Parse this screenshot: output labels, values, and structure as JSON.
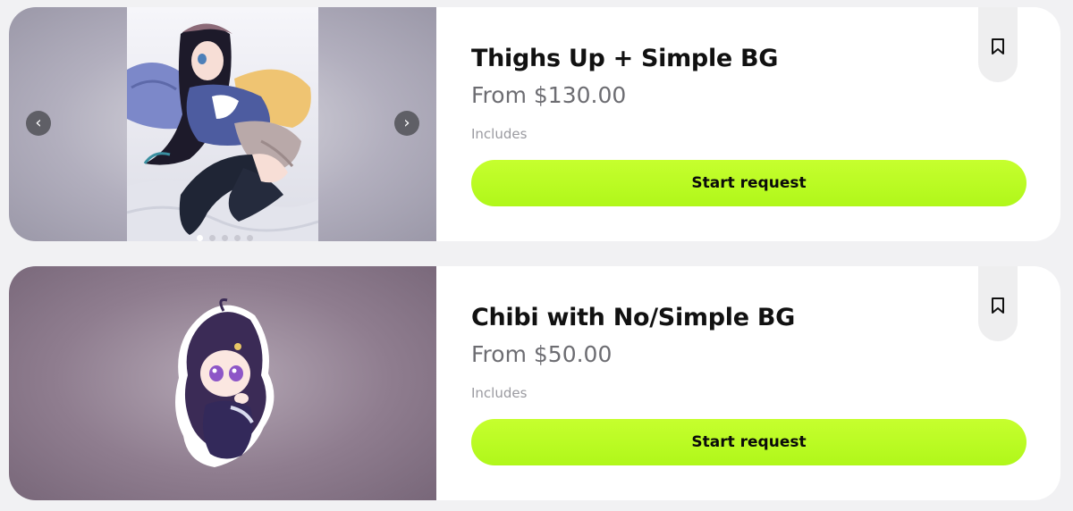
{
  "cards": [
    {
      "title": "Thighs Up + Simple BG",
      "price": "From $130.00",
      "includes_label": "Includes",
      "cta_label": "Start request",
      "carousel": {
        "slide_count": 5,
        "active_index": 0,
        "prev_icon": "chevron-left-icon",
        "next_icon": "chevron-right-icon"
      },
      "bookmark_icon": "bookmark-icon"
    },
    {
      "title": "Chibi with No/Simple BG",
      "price": "From $50.00",
      "includes_label": "Includes",
      "cta_label": "Start request",
      "bookmark_icon": "bookmark-icon"
    }
  ],
  "colors": {
    "accent": "#b6fb1f",
    "card_bg": "#ffffff",
    "page_bg": "#f1f1f3"
  }
}
